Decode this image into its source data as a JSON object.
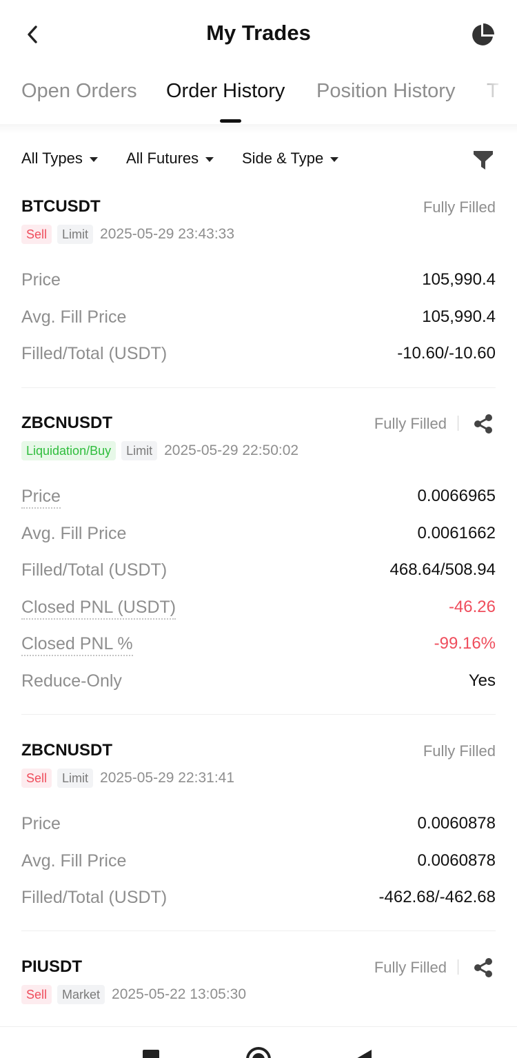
{
  "header": {
    "title": "My Trades",
    "back_icon": "chevron-left-icon",
    "right_icon": "pie-chart-icon"
  },
  "tabs": [
    {
      "label": "Open Orders",
      "active": false
    },
    {
      "label": "Order History",
      "active": true
    },
    {
      "label": "Position History",
      "active": false
    },
    {
      "label": "T",
      "active": false
    }
  ],
  "filters": {
    "types": "All Types",
    "futures": "All Futures",
    "side_type": "Side & Type",
    "filter_icon": "funnel-icon"
  },
  "orders": [
    {
      "symbol": "BTCUSDT",
      "status": "Fully Filled",
      "side": "Sell",
      "order_type": "Limit",
      "time": "2025-05-29 23:43:33",
      "shareable": false,
      "rows": [
        {
          "label": "Price",
          "value": "105,990.4"
        },
        {
          "label": "Avg. Fill Price",
          "value": "105,990.4"
        },
        {
          "label": "Filled/Total (USDT)",
          "value": "-10.60/-10.60"
        }
      ]
    },
    {
      "symbol": "ZBCNUSDT",
      "status": "Fully Filled",
      "side": "Liquidation/Buy",
      "order_type": "Limit",
      "time": "2025-05-29 22:50:02",
      "shareable": true,
      "rows": [
        {
          "label": "Price",
          "value": "0.0066965"
        },
        {
          "label": "Avg. Fill Price",
          "value": "0.0061662"
        },
        {
          "label": "Filled/Total (USDT)",
          "value": "468.64/508.94"
        },
        {
          "label": "Closed PNL (USDT)",
          "value": "-46.26"
        },
        {
          "label": "Closed PNL %",
          "value": "-99.16%"
        },
        {
          "label": "Reduce-Only",
          "value": "Yes"
        }
      ]
    },
    {
      "symbol": "ZBCNUSDT",
      "status": "Fully Filled",
      "side": "Sell",
      "order_type": "Limit",
      "time": "2025-05-29 22:31:41",
      "shareable": false,
      "rows": [
        {
          "label": "Price",
          "value": "0.0060878"
        },
        {
          "label": "Avg. Fill Price",
          "value": "0.0060878"
        },
        {
          "label": "Filled/Total (USDT)",
          "value": "-462.68/-462.68"
        }
      ]
    },
    {
      "symbol": "PIUSDT",
      "status": "Fully Filled",
      "side": "Sell",
      "order_type": "Market",
      "time": "2025-05-22 13:05:30",
      "shareable": true,
      "rows": []
    }
  ],
  "colors": {
    "sell": "#ef4d5c",
    "buy": "#2ebd3c",
    "muted": "#8e8e8e",
    "text": "#111111"
  },
  "navbar": {
    "icons": [
      "recent-apps-icon",
      "home-icon",
      "back-triangle-icon"
    ]
  }
}
